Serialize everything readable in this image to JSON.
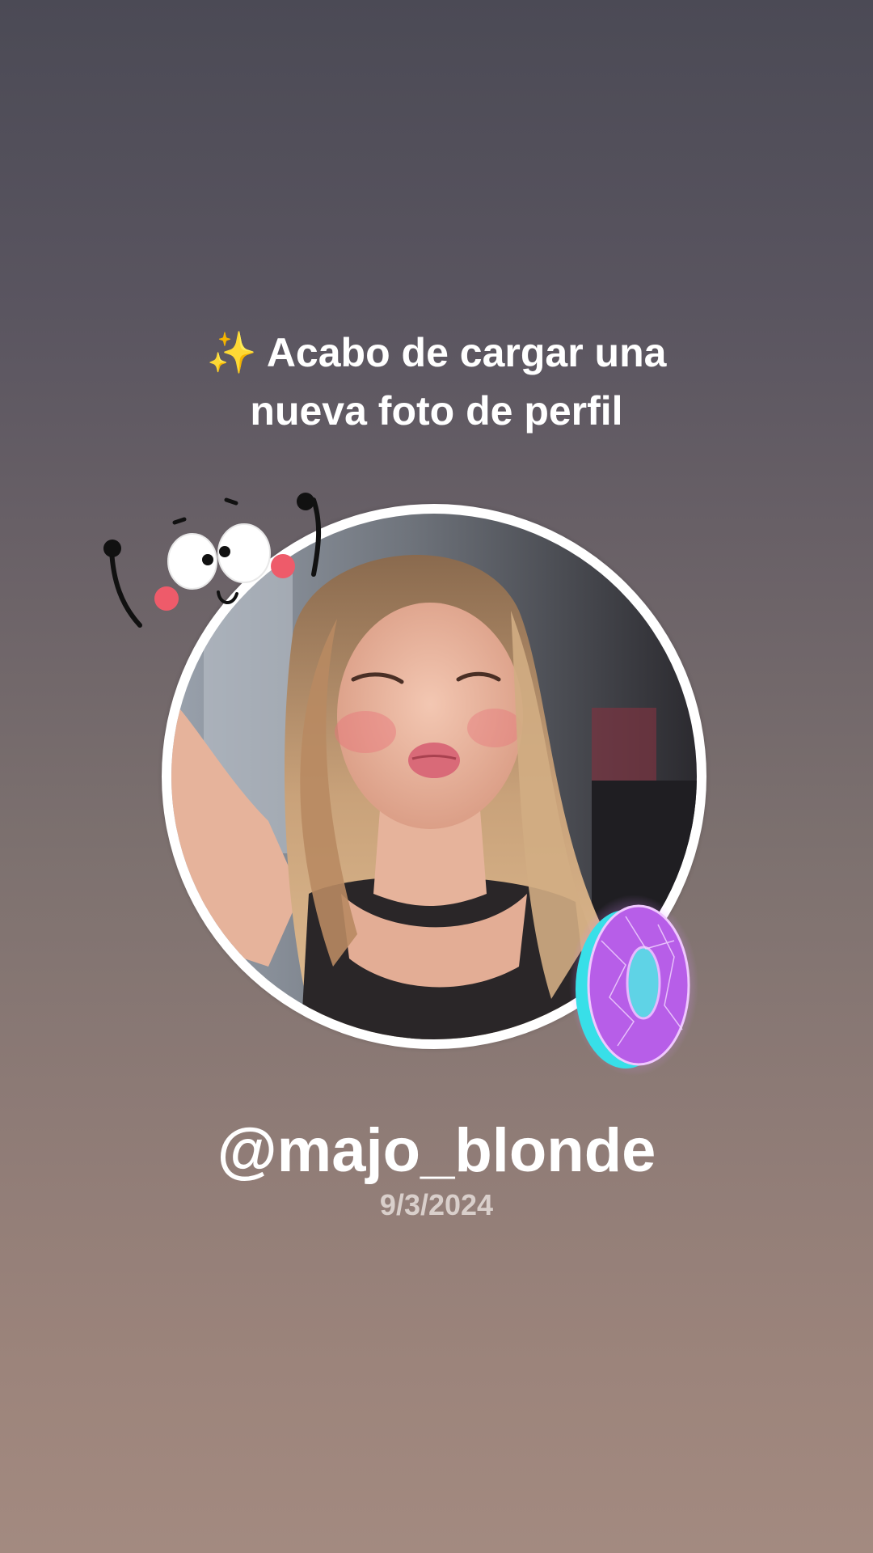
{
  "headline": {
    "sparkle_icon": "sparkles-icon",
    "sparkle_glyph": "✨",
    "line1": "Acabo de cargar una",
    "line2": "nueva foto de perfil"
  },
  "profile": {
    "photo_icon": "profile-photo",
    "username": "@majo_blonde",
    "date": "9/3/2024"
  },
  "stickers": {
    "face": "cartoon-face-sticker",
    "donut": "glowing-donut-sticker"
  },
  "colors": {
    "text": "#ffffff",
    "date": "#d9cfcb",
    "sparkle": "#f6c84b",
    "donut_purple": "#b45cf0",
    "donut_cyan": "#39e6f0"
  }
}
